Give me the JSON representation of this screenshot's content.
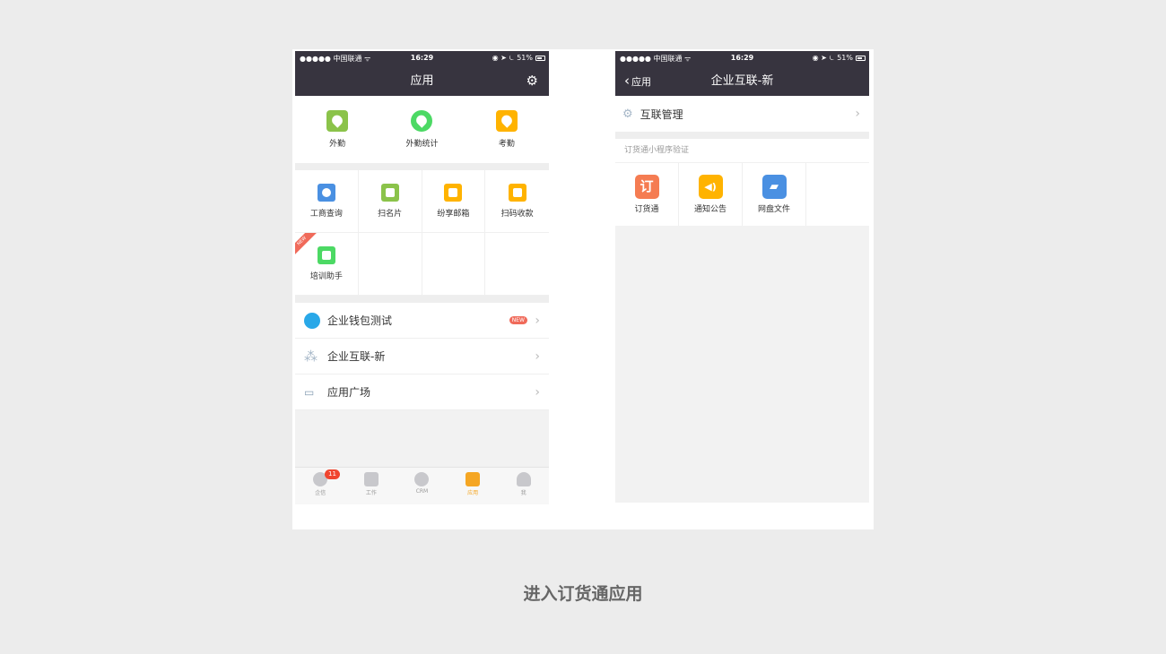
{
  "status_bar": {
    "carrier": "●●●●● 中国联通 ᯤ",
    "time": "16:29",
    "right": "◉ ➤ ⏾ 51%"
  },
  "left_screen": {
    "title": "应用",
    "settings_icon": "gear-icon",
    "top_apps": [
      {
        "label": "外勤",
        "color": "#8bc34a"
      },
      {
        "label": "外勤统计",
        "color": "#4cd964"
      },
      {
        "label": "考勤",
        "color": "#ffb300"
      }
    ],
    "grid_apps": [
      {
        "label": "工商查询",
        "color": "#4a90e2"
      },
      {
        "label": "扫名片",
        "color": "#8bc34a"
      },
      {
        "label": "纷享邮箱",
        "color": "#ffb300"
      },
      {
        "label": "扫码收款",
        "color": "#ffb300"
      },
      {
        "label": "培训助手",
        "color": "#4cd964",
        "ribbon": "NEW"
      }
    ],
    "list": [
      {
        "label": "企业钱包测试",
        "badge": "NEW",
        "icon": "wallet-icon"
      },
      {
        "label": "企业互联-新",
        "icon": "network-icon"
      },
      {
        "label": "应用广场",
        "icon": "store-icon"
      }
    ],
    "tabs": [
      {
        "label": "企信",
        "badge": "11"
      },
      {
        "label": "工作"
      },
      {
        "label": "CRM"
      },
      {
        "label": "应用",
        "active": true
      },
      {
        "label": "我"
      }
    ]
  },
  "right_screen": {
    "back_label": "应用",
    "title": "企业互联-新",
    "setting_label": "互联管理",
    "section_title": "订货通小程序验证",
    "apps": [
      {
        "label": "订货通",
        "glyph": "订",
        "color": "#f57c52"
      },
      {
        "label": "通知公告",
        "glyph": "◀)",
        "color": "#ffb300"
      },
      {
        "label": "网盘文件",
        "glyph": "▰",
        "color": "#4a90e2"
      }
    ]
  },
  "caption": "进入订货通应用"
}
